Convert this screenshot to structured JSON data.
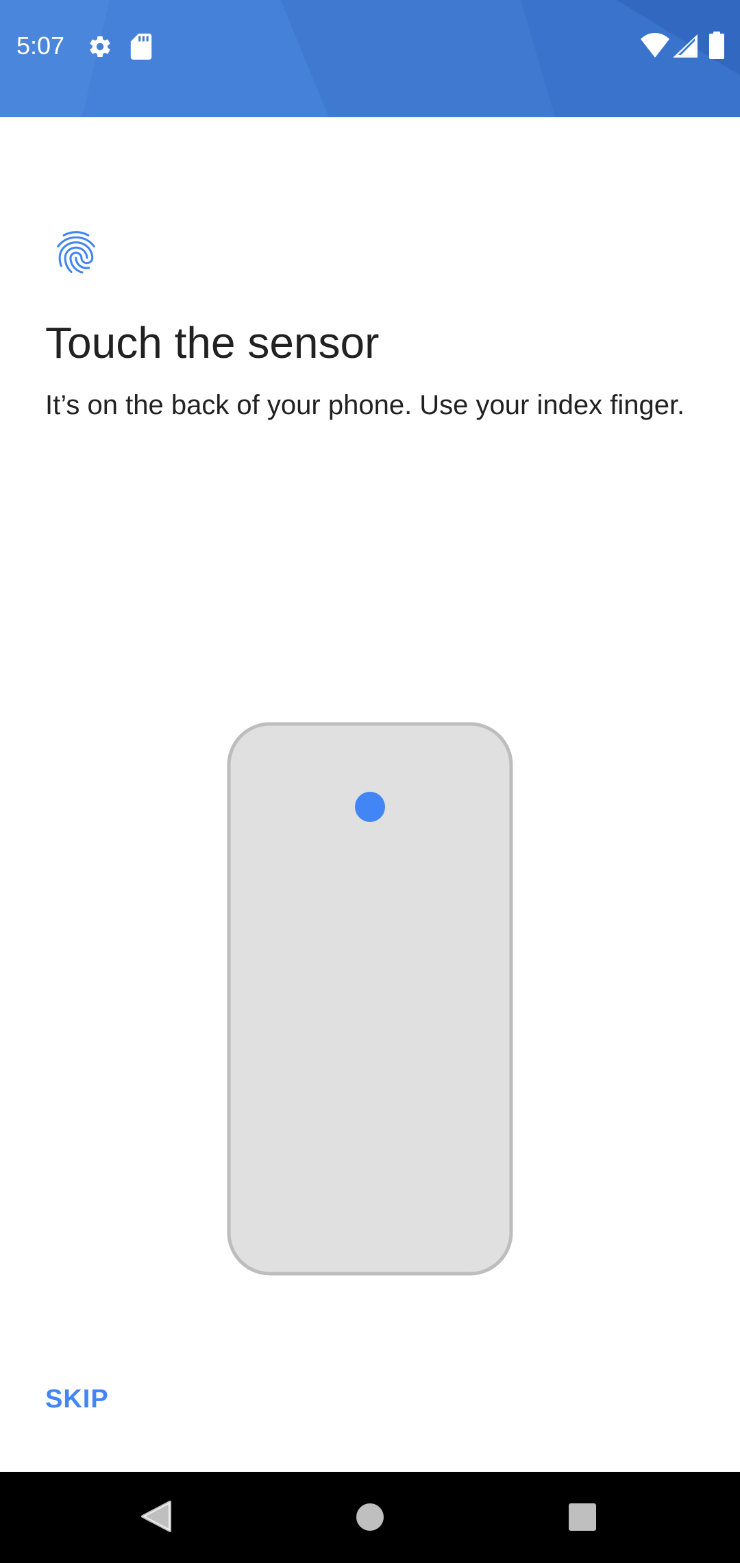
{
  "status_bar": {
    "time": "5:07",
    "icons": [
      "settings-icon",
      "sd-card-icon",
      "wifi-icon",
      "cell-signal-icon",
      "battery-icon"
    ],
    "background_color": "#3d78d0"
  },
  "fingerprint_setup": {
    "icon": "fingerprint-icon",
    "title": "Touch the sensor",
    "description": "It’s on the back of your phone. Use your index finger.",
    "illustration": "phone-back-illustration",
    "sensor_color": "#4285f4",
    "skip_label": "SKIP"
  },
  "nav_bar": {
    "buttons": [
      "back-icon",
      "home-icon",
      "recents-icon"
    ]
  }
}
